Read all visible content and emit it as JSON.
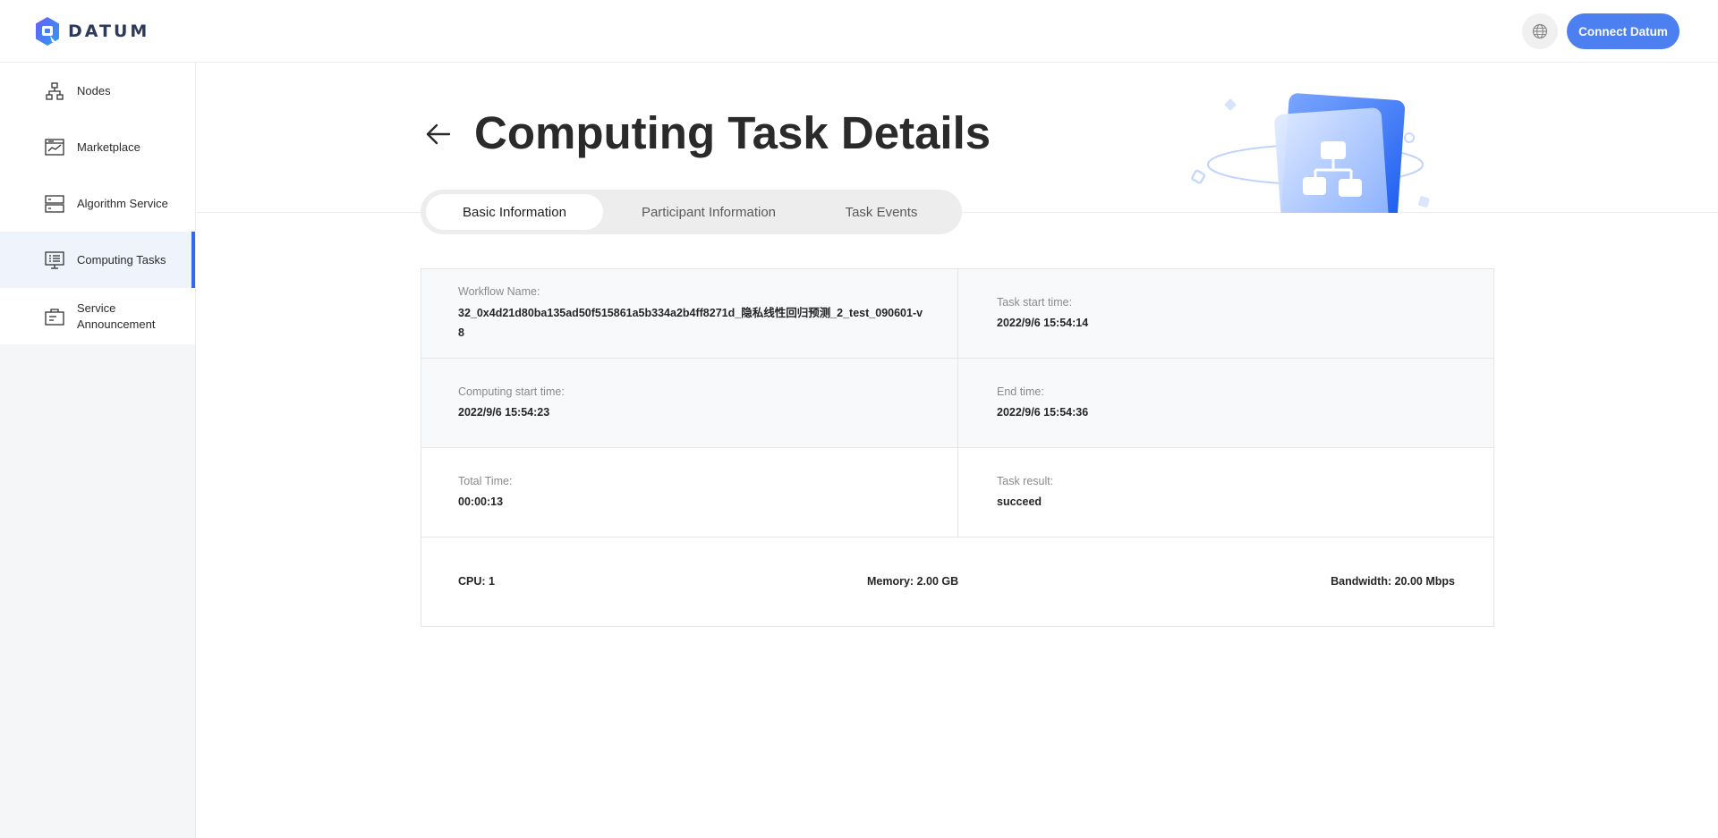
{
  "brand": {
    "name": "DATUM"
  },
  "header": {
    "connect_label": "Connect Datum"
  },
  "sidebar": {
    "items": [
      {
        "label": "Nodes",
        "icon": "nodes-icon"
      },
      {
        "label": "Marketplace",
        "icon": "marketplace-icon"
      },
      {
        "label": "Algorithm Service",
        "icon": "algorithm-icon"
      },
      {
        "label": "Computing Tasks",
        "icon": "computing-icon",
        "active": true
      },
      {
        "label": "Service Announcement",
        "icon": "announcement-icon"
      }
    ]
  },
  "page": {
    "title": "Computing Task Details",
    "tabs": [
      {
        "label": "Basic Information",
        "active": true
      },
      {
        "label": "Participant Information"
      },
      {
        "label": "Task Events"
      }
    ]
  },
  "details": {
    "workflow_name_label": "Workflow Name:",
    "workflow_name": "32_0x4d21d80ba135ad50f515861a5b334a2b4ff8271d_隐私线性回归预测_2_test_090601-v8",
    "task_start_label": "Task start time:",
    "task_start": "2022/9/6 15:54:14",
    "computing_start_label": "Computing start time:",
    "computing_start": "2022/9/6 15:54:23",
    "end_time_label": "End time:",
    "end_time": "2022/9/6 15:54:36",
    "total_time_label": "Total Time:",
    "total_time": "00:00:13",
    "task_result_label": "Task result:",
    "task_result": "succeed"
  },
  "resources": {
    "cpu": "CPU:  1",
    "memory": "Memory:  2.00 GB",
    "bandwidth": "Bandwidth:  20.00 Mbps"
  },
  "colors": {
    "accent": "#4c7ff0",
    "active_bar": "#2e6bf2"
  }
}
